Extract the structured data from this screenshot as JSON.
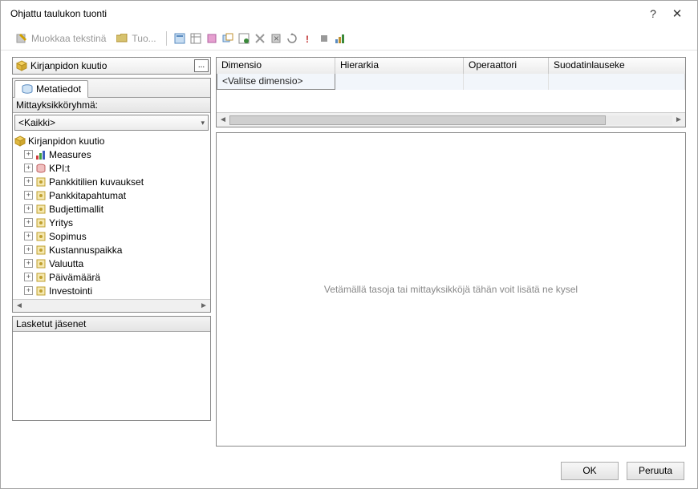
{
  "window": {
    "title": "Ohjattu taulukon tuonti"
  },
  "toolbar": {
    "edit_text": "Muokkaa tekstinä",
    "import": "Tuo..."
  },
  "cube": {
    "name": "Kirjanpidon kuutio",
    "browse": "..."
  },
  "tabs": {
    "metadata": "Metatiedot"
  },
  "group": {
    "label": "Mittayksikköryhmä:",
    "value": "<Kaikki>"
  },
  "tree": {
    "root": "Kirjanpidon kuutio",
    "items": [
      "Measures",
      "KPI:t",
      "Pankkitilien kuvaukset",
      "Pankkitapahtumat",
      "Budjettimallit",
      "Yritys",
      "Sopimus",
      "Kustannuspaikka",
      "Valuutta",
      "Päivämäärä",
      "Investointi"
    ]
  },
  "calc": {
    "header": "Lasketut jäsenet"
  },
  "grid": {
    "cols": [
      "Dimensio",
      "Hierarkia",
      "Operaattori",
      "Suodatinlauseke"
    ],
    "placeholder_row": "<Valitse dimensio>"
  },
  "drop": {
    "hint": "Vetämällä tasoja tai mittayksikköjä tähän voit lisätä ne kysel"
  },
  "buttons": {
    "ok": "OK",
    "cancel": "Peruuta"
  }
}
